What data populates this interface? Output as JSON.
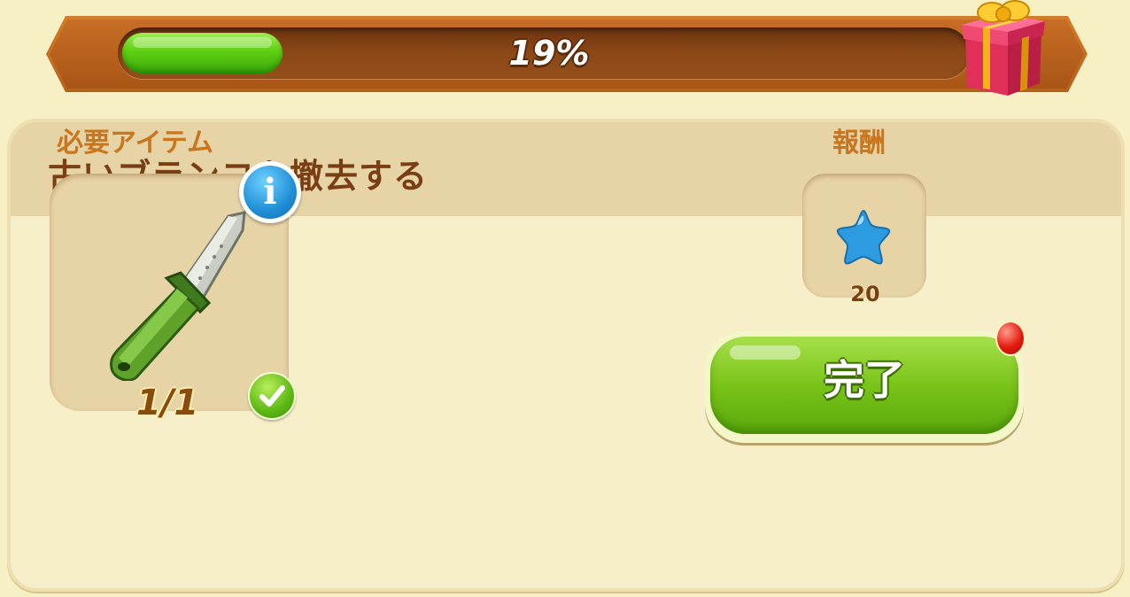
{
  "progress": {
    "percent_label": "19%",
    "fraction": 0.19,
    "reward_icon": "gift-box-icon"
  },
  "task": {
    "title": "古いブランコを撤去する",
    "required_label": "必要アイテム",
    "reward_label": "報酬",
    "required_item": {
      "icon": "knife-icon",
      "count_label": "1/1",
      "status_icon": "check-icon",
      "info_icon": "info-icon"
    },
    "reward": {
      "icon": "blue-star-icon",
      "amount": "20"
    },
    "complete_button_label": "完了"
  },
  "colors": {
    "progress_fill": "#5fcf12",
    "title_text": "#7a3e14",
    "section_label": "#c9761e",
    "button_green": "#79c419",
    "notification_red": "#e31b10",
    "star_blue": "#2c9be0"
  }
}
